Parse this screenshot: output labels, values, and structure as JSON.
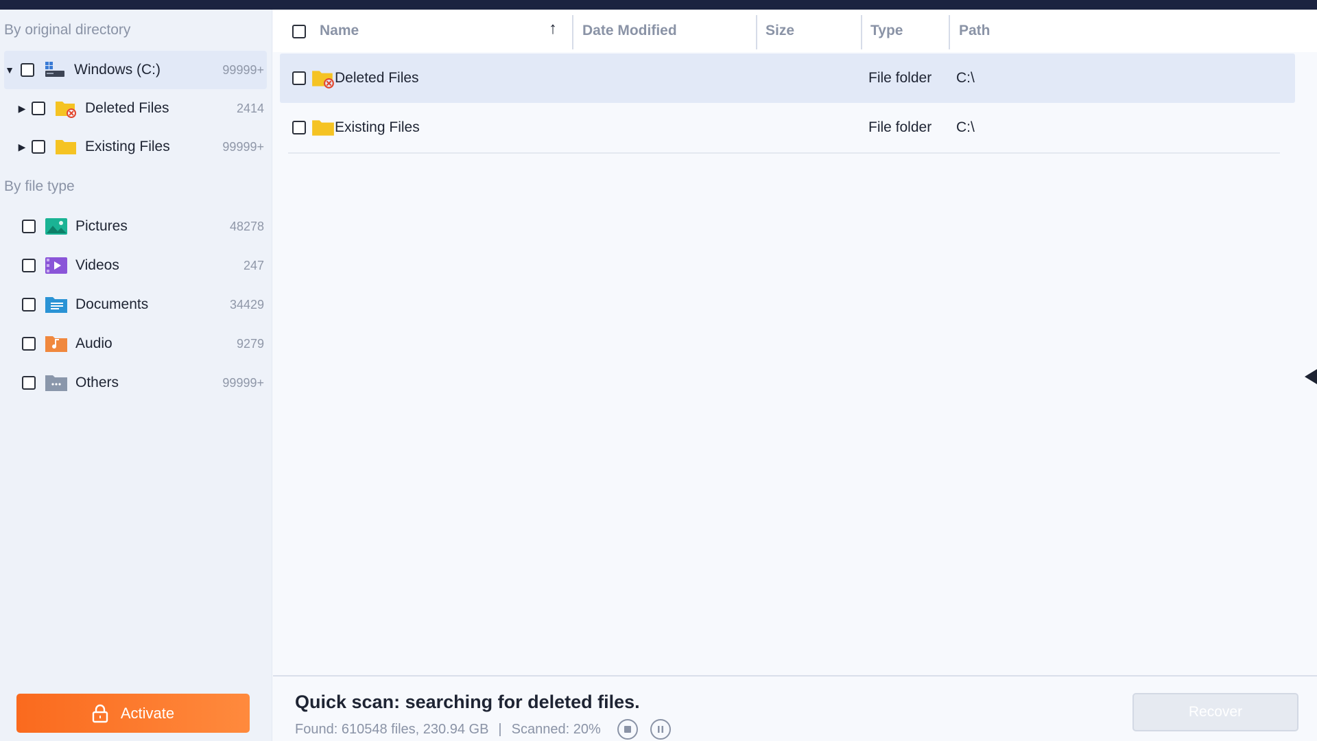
{
  "sidebar": {
    "section_directory": "By original directory",
    "section_filetype": "By file type",
    "drive": {
      "label": "Windows (C:)",
      "count": "99999+"
    },
    "dir_items": [
      {
        "label": "Deleted Files",
        "count": "2414"
      },
      {
        "label": "Existing Files",
        "count": "99999+"
      }
    ],
    "type_items": [
      {
        "label": "Pictures",
        "count": "48278",
        "icon": "pictures-icon"
      },
      {
        "label": "Videos",
        "count": "247",
        "icon": "videos-icon"
      },
      {
        "label": "Documents",
        "count": "34429",
        "icon": "documents-icon"
      },
      {
        "label": "Audio",
        "count": "9279",
        "icon": "audio-icon"
      },
      {
        "label": "Others",
        "count": "99999+",
        "icon": "others-icon"
      }
    ],
    "activate_label": "Activate"
  },
  "table": {
    "columns": {
      "name": "Name",
      "date_modified": "Date Modified",
      "size": "Size",
      "type": "Type",
      "path": "Path"
    },
    "sort_indicator": "↑",
    "rows": [
      {
        "name": "Deleted Files",
        "type": "File folder",
        "path": "C:\\"
      },
      {
        "name": "Existing Files",
        "type": "File folder",
        "path": "C:\\"
      }
    ]
  },
  "status": {
    "title": "Quick scan: searching for deleted files.",
    "found": "Found: 610548 files, 230.94 GB",
    "separator": "|",
    "scanned": "Scanned: 20%",
    "recover_label": "Recover"
  },
  "colors": {
    "accent_orange": "#fa6a1e",
    "topbar": "#1b2340",
    "selected_row": "#e2e9f7"
  }
}
